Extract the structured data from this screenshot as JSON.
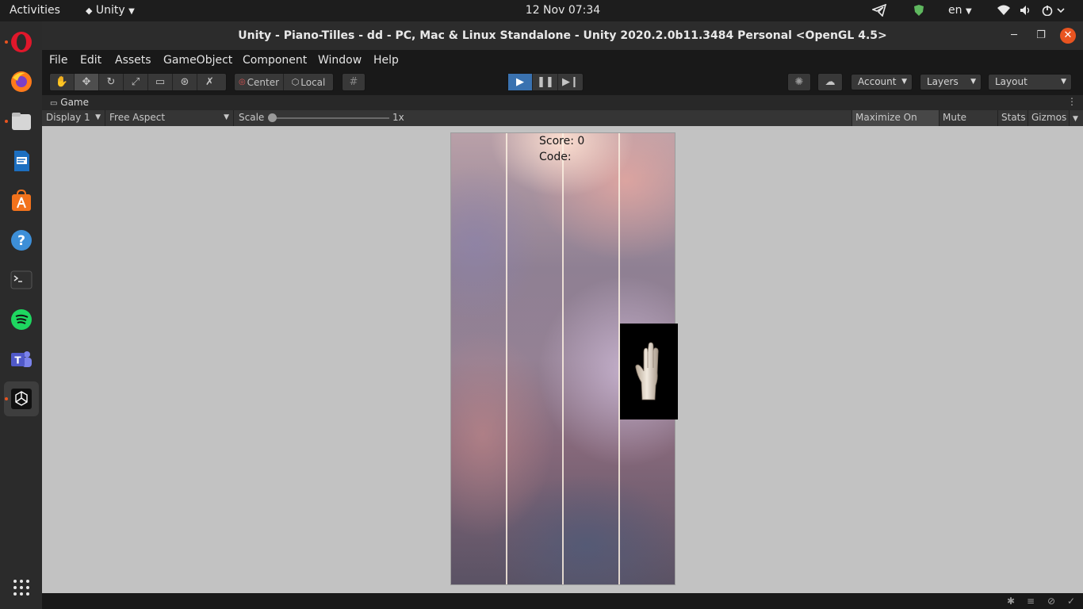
{
  "topbar": {
    "activities": "Activities",
    "app_name": "Unity",
    "clock": "12 Nov  07:34",
    "language": "en"
  },
  "dock": {
    "items": [
      "opera-icon",
      "firefox-icon",
      "files-icon",
      "libreoffice-writer-icon",
      "software-center-icon",
      "help-icon",
      "terminal-icon",
      "spotify-icon",
      "teams-icon",
      "unity-icon",
      "show-apps-icon"
    ]
  },
  "window": {
    "title": "Unity - Piano-Tilles - dd - PC, Mac & Linux Standalone - Unity 2020.2.0b11.3484 Personal <OpenGL 4.5>"
  },
  "menubar": {
    "items": [
      "File",
      "Edit",
      "Assets",
      "GameObject",
      "Component",
      "Window",
      "Help"
    ]
  },
  "toolbar": {
    "pivot_label": "Center",
    "space_label": "Local",
    "account_label": "Account",
    "layers_label": "Layers",
    "layout_label": "Layout"
  },
  "game_tab": {
    "label": "Game"
  },
  "gamebar": {
    "display": "Display 1",
    "aspect": "Free Aspect",
    "scale_label": "Scale",
    "scale_value": "1x",
    "maximize_on_play": "Maximize On Play",
    "mute_audio": "Mute Audio",
    "stats": "Stats",
    "gizmos": "Gizmos"
  },
  "game": {
    "score": "Score: 0",
    "code": "Code:",
    "lanes": 4,
    "tile_lane": 4,
    "tile_symbol": "hand-sign-three-fingers"
  },
  "colors": {
    "play_active": "#3a72b0",
    "close_button": "#e95420",
    "dock_indicator": "#e95420"
  }
}
